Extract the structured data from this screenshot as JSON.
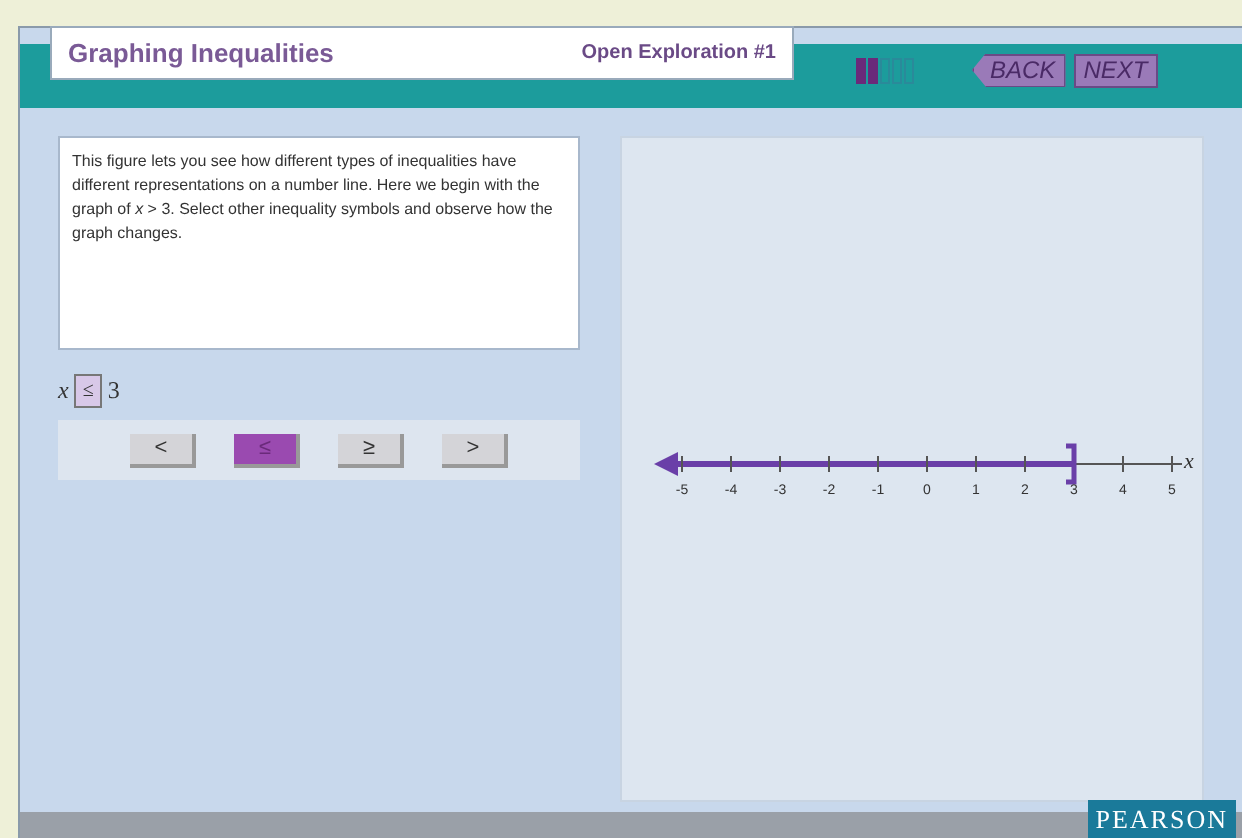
{
  "header": {
    "title": "Graphing Inequalities",
    "subtitle": "Open Exploration #1",
    "progress": [
      {
        "filled": true
      },
      {
        "filled": true
      },
      {
        "filled": false
      },
      {
        "filled": false
      },
      {
        "filled": false
      }
    ],
    "nav_buttons": [
      {
        "label": "BACK",
        "kind": "back"
      },
      {
        "label": "NEXT",
        "kind": "next"
      }
    ]
  },
  "description": "This figure lets you see how different types of inequalities have different representations on a number line. Here we begin with the graph of *x* > 3. Select other inequality symbols and observe how the graph changes.",
  "expression": {
    "variable": "x",
    "symbol": "≤",
    "value": "3"
  },
  "symbol_buttons": [
    {
      "label": "<",
      "selected": false
    },
    {
      "label": "≤",
      "selected": true
    },
    {
      "label": "≥",
      "selected": false
    },
    {
      "label": ">",
      "selected": false
    }
  ],
  "number_line": {
    "axis_label": "x",
    "closed": true,
    "points_left": true,
    "ticks": [
      "-5",
      "-4",
      "-3",
      "-2",
      "-1",
      "0",
      "1",
      "2",
      "3",
      "4",
      "5"
    ]
  },
  "footer": {
    "logo": "PEARSON"
  }
}
